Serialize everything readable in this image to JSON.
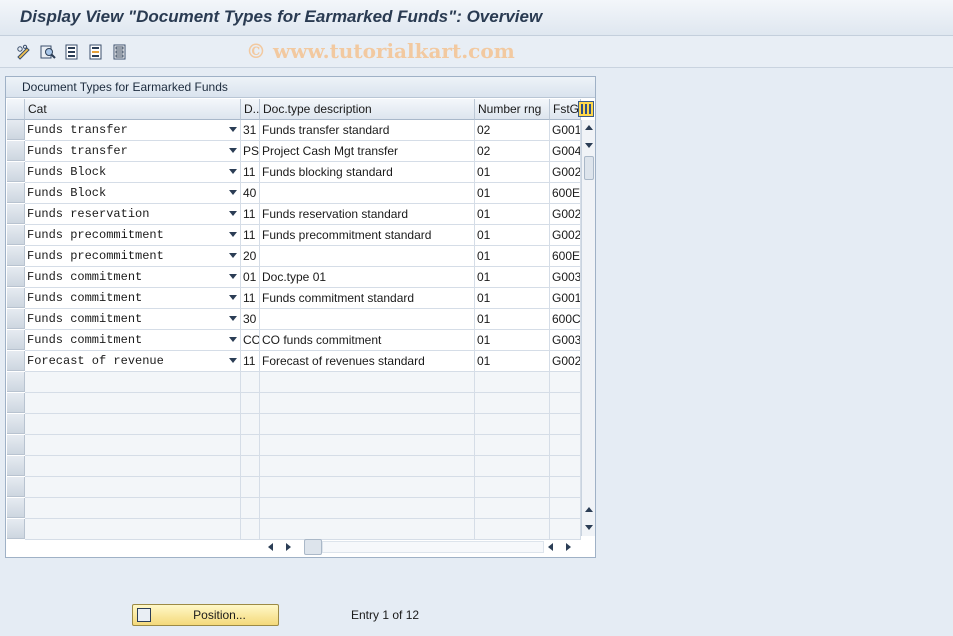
{
  "window": {
    "title": "Display View \"Document Types for Earmarked Funds\": Overview",
    "watermark": "© www.tutorialkart.com"
  },
  "toolbar": {
    "icons": [
      "pencil-glasses-icon",
      "find-icon",
      "select-all-icon",
      "select-block-icon",
      "deselect-all-icon"
    ]
  },
  "table": {
    "title": "Document Types for Earmarked Funds",
    "columns": [
      "Cat",
      "D..",
      "Doc.type description",
      "Number rng",
      "FstG"
    ],
    "rows": [
      {
        "cat": "Funds transfer",
        "doc": "31",
        "desc": "Funds transfer standard",
        "rng": "02",
        "fst": "G001"
      },
      {
        "cat": "Funds transfer",
        "doc": "PS",
        "desc": "Project Cash Mgt transfer",
        "rng": "02",
        "fst": "G004"
      },
      {
        "cat": "Funds Block",
        "doc": "11",
        "desc": "Funds blocking standard",
        "rng": "01",
        "fst": "G002"
      },
      {
        "cat": "Funds Block",
        "doc": "40",
        "desc": "",
        "rng": "01",
        "fst": "600E"
      },
      {
        "cat": "Funds reservation",
        "doc": "11",
        "desc": "Funds reservation standard",
        "rng": "01",
        "fst": "G002"
      },
      {
        "cat": "Funds precommitment",
        "doc": "11",
        "desc": "Funds precommitment standard",
        "rng": "01",
        "fst": "G002"
      },
      {
        "cat": "Funds precommitment",
        "doc": "20",
        "desc": "",
        "rng": "01",
        "fst": "600E"
      },
      {
        "cat": "Funds commitment",
        "doc": "01",
        "desc": "Doc.type 01",
        "rng": "01",
        "fst": "G003"
      },
      {
        "cat": "Funds commitment",
        "doc": "11",
        "desc": "Funds commitment standard",
        "rng": "01",
        "fst": "G001"
      },
      {
        "cat": "Funds commitment",
        "doc": "30",
        "desc": "",
        "rng": "01",
        "fst": "600C"
      },
      {
        "cat": "Funds commitment",
        "doc": "CO",
        "desc": "CO funds commitment",
        "rng": "01",
        "fst": "G003"
      },
      {
        "cat": "Forecast of revenue",
        "doc": "11",
        "desc": "Forecast of revenues standard",
        "rng": "01",
        "fst": "G002"
      }
    ]
  },
  "footer": {
    "position_label": "Position...",
    "entry_text": "Entry 1 of 12"
  }
}
